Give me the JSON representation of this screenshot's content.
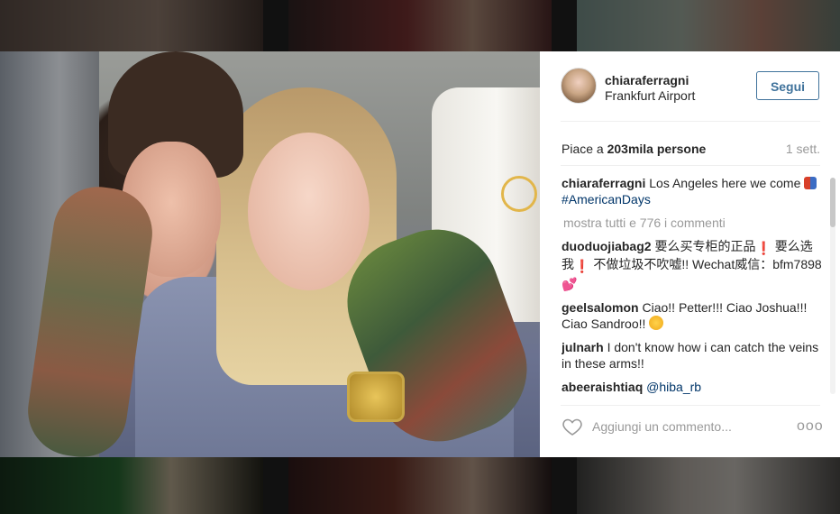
{
  "post": {
    "username": "chiaraferragni",
    "location": "Frankfurt Airport",
    "follow_label": "Segui",
    "likes_prefix": "Piace a ",
    "likes_count": "203mila persone",
    "timestamp": "1 sett."
  },
  "caption": {
    "user": "chiaraferragni",
    "text": "Los Angeles here we come",
    "hashtag": "#AmericanDays"
  },
  "view_all_comments": "mostra tutti e 776 i commenti",
  "comments": [
    {
      "user": "duoduojiabag2",
      "text_a": "要么买专柜的正品",
      "text_b": "要么选我",
      "text_c": "不做垃圾不吹嘘!! Wechat威信：bfm7898"
    },
    {
      "user": "geelsalomon",
      "text": "Ciao!! Petter!!! Ciao Joshua!!! Ciao Sandroo!!"
    },
    {
      "user": "julnarh",
      "text": "I don't know how i can catch the veins in these arms!!"
    },
    {
      "user": "abeeraishtiaq",
      "text": "@hiba_rb"
    }
  ],
  "footer": {
    "comment_placeholder": "Aggiungi un commento...",
    "more_options": "ooo"
  },
  "colors": {
    "accent": "#3f729b",
    "text": "#262626",
    "muted": "#999999"
  }
}
